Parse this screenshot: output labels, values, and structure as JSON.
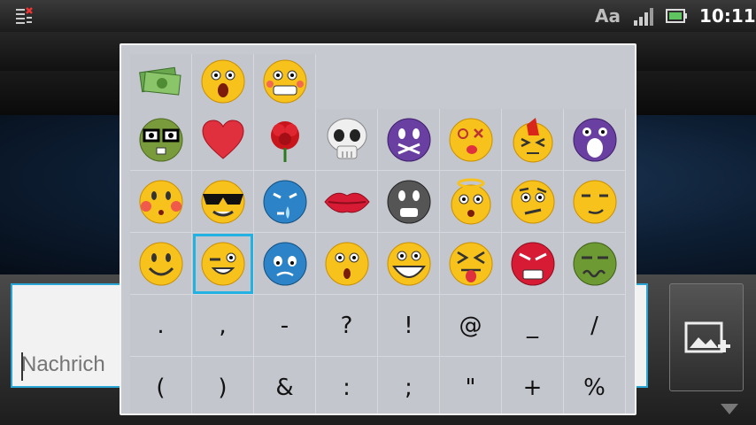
{
  "status_bar": {
    "time": "10:11",
    "font_indicator": "Aa",
    "icons": [
      "notification-icon",
      "signal-icon",
      "battery-icon"
    ]
  },
  "compose": {
    "placeholder": "Nachrich",
    "accent_color": "#2aa6d6"
  },
  "attach_button": {
    "icon": "add-image-icon"
  },
  "emoji_panel": {
    "top_row": [
      "money",
      "shocked",
      "grimace"
    ],
    "emoji_rows": [
      [
        "nerd",
        "heart",
        "rose",
        "skull",
        "zipped-mouth",
        "dizzy",
        "mohawk",
        "screaming"
      ],
      [
        "blushing",
        "cool",
        "crying",
        "lips",
        "neutral",
        "angel",
        "thinking",
        "smirk"
      ],
      [
        "smile",
        "winking",
        "sad-blue",
        "surprised",
        "grinning",
        "tongue-out",
        "angry",
        "sick"
      ]
    ],
    "selected": "winking",
    "symbols_row1": [
      ".",
      ",",
      "-",
      "?",
      "!",
      "@",
      "_",
      "/"
    ],
    "symbols_row2": [
      "(",
      ")",
      "&",
      ":",
      ";",
      "\"",
      "+",
      "%"
    ]
  }
}
